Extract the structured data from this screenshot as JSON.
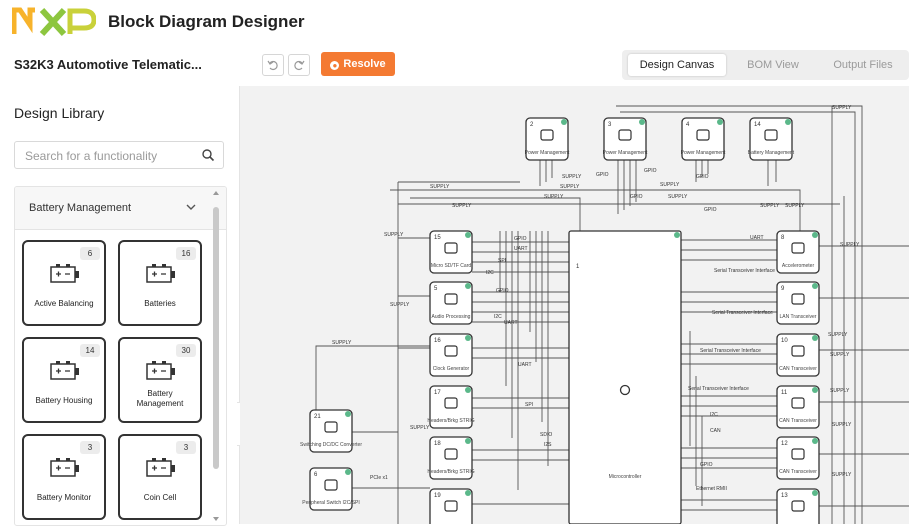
{
  "header": {
    "brand": "NXP",
    "app_title": "Block Diagram Designer"
  },
  "toolbar": {
    "project_title": "S32K3 Automotive Telematic...",
    "undo_icon": "undo-icon",
    "redo_icon": "redo-icon",
    "resolve_label": "Resolve",
    "resolve_color": "#f47a32",
    "tabs": [
      {
        "label": "Design Canvas",
        "active": true
      },
      {
        "label": "BOM View",
        "active": false
      },
      {
        "label": "Output Files",
        "active": false
      }
    ]
  },
  "sidebar": {
    "title": "Design Library",
    "search_placeholder": "Search for a functionality",
    "category": "Battery Management",
    "cards": [
      {
        "label": "Active Balancing",
        "count": "6"
      },
      {
        "label": "Batteries",
        "count": "16"
      },
      {
        "label": "Battery Housing",
        "count": "14"
      },
      {
        "label": "Battery Management",
        "count": "30"
      },
      {
        "label": "Battery Monitor",
        "count": "3"
      },
      {
        "label": "Coin Cell",
        "count": "3"
      }
    ]
  },
  "canvas": {
    "top_blocks": [
      {
        "num": "2",
        "label": "Power Management"
      },
      {
        "num": "3",
        "label": "Power Management"
      },
      {
        "num": "4",
        "label": "Power Management"
      },
      {
        "num": "14",
        "label": "Battery Management"
      }
    ],
    "left_blocks": [
      {
        "num": "15",
        "label": "Micro SD/TF Card"
      },
      {
        "num": "5",
        "label": "Audio Processing"
      },
      {
        "num": "16",
        "label": "Clock Generator"
      },
      {
        "num": "17",
        "label": "Headers/Brkg STRIG"
      },
      {
        "num": "18",
        "label": "Headers/Brkg STRIG"
      },
      {
        "num": "19",
        "label": ""
      }
    ],
    "far_left_blocks": [
      {
        "num": "21",
        "label": "Switching DC/DC Converter"
      },
      {
        "num": "6",
        "label": "Peripheral Switch I2C/SPI"
      }
    ],
    "right_blocks": [
      {
        "num": "8",
        "label": "Accelerometer"
      },
      {
        "num": "9",
        "label": "LAN Transceiver"
      },
      {
        "num": "10",
        "label": "CAN Transceiver"
      },
      {
        "num": "11",
        "label": "CAN Transceiver"
      },
      {
        "num": "12",
        "label": "CAN Transceiver"
      },
      {
        "num": "13",
        "label": ""
      }
    ],
    "mcu": {
      "num": "1",
      "label": "Microcontroller"
    },
    "wire_labels": {
      "supply": "SUPPLY",
      "gpio": "GPIO",
      "uart": "UART",
      "spi": "SPI",
      "i2c": "I2C",
      "serial": "Serial Transceiver Interface",
      "i2s": "I2S",
      "pcie": "PCIe x1",
      "can": "CAN",
      "eth": "Ethernet RMII",
      "sdio": "SDIO"
    }
  },
  "colors": {
    "status_dot": "#5bb88a",
    "canvas_bg": "#f2f2f2"
  }
}
